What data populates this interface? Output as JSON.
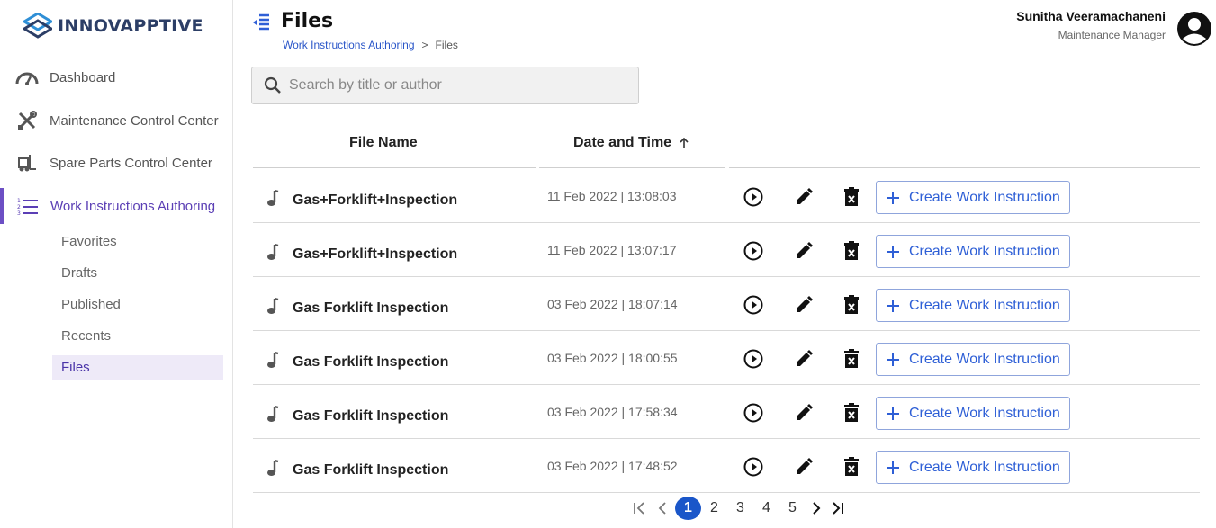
{
  "brand": {
    "name": "INNOVAPPTIVE",
    "color": "#2c3e66"
  },
  "sidebar": {
    "items": [
      {
        "label": "Dashboard",
        "icon": "speedometer-icon"
      },
      {
        "label": "Maintenance Control Center",
        "icon": "tools-icon"
      },
      {
        "label": "Spare Parts Control Center",
        "icon": "forklift-icon"
      },
      {
        "label": "Work Instructions Authoring",
        "icon": "list-numbered-icon",
        "active": true
      }
    ],
    "subitems": [
      {
        "label": "Favorites"
      },
      {
        "label": "Drafts"
      },
      {
        "label": "Published"
      },
      {
        "label": "Recents"
      },
      {
        "label": "Files",
        "active": true
      }
    ],
    "active_color": "#6c4fc4"
  },
  "header": {
    "title": "Files",
    "breadcrumb": {
      "parent": "Work Instructions Authoring",
      "separator": ">",
      "current": "Files"
    },
    "user": {
      "name": "Sunitha Veeramachaneni",
      "role": "Maintenance Manager"
    }
  },
  "search": {
    "placeholder": "Search by title or author",
    "value": ""
  },
  "table": {
    "columns": {
      "file_name": "File Name",
      "date_time": "Date and Time"
    },
    "sort": {
      "column": "date_time",
      "direction": "ascending",
      "icon": "arrow-up-icon"
    },
    "rows": [
      {
        "file_name": "Gas+Forklift+Inspection",
        "date": "11 Feb 2022 | 13:08:03",
        "action_label": "Create Work Instruction"
      },
      {
        "file_name": "Gas+Forklift+Inspection",
        "date": "11 Feb 2022 | 13:07:17",
        "action_label": "Create Work Instruction"
      },
      {
        "file_name": "Gas Forklift Inspection",
        "date": "03 Feb 2022 | 18:07:14",
        "action_label": "Create Work Instruction"
      },
      {
        "file_name": "Gas Forklift Inspection",
        "date": "03 Feb 2022 | 18:00:55",
        "action_label": "Create Work Instruction"
      },
      {
        "file_name": "Gas Forklift Inspection",
        "date": "03 Feb 2022 | 17:58:34",
        "action_label": "Create Work Instruction"
      },
      {
        "file_name": "Gas Forklift Inspection",
        "date": "03 Feb 2022 | 17:48:52",
        "action_label": "Create Work Instruction"
      }
    ],
    "row_icons": [
      "music-note-icon",
      "play-circle-icon",
      "pencil-icon",
      "trash-icon",
      "plus-icon"
    ]
  },
  "pagination": {
    "pages": [
      "1",
      "2",
      "3",
      "4",
      "5"
    ],
    "current": "1",
    "current_color": "#1a56c9"
  }
}
